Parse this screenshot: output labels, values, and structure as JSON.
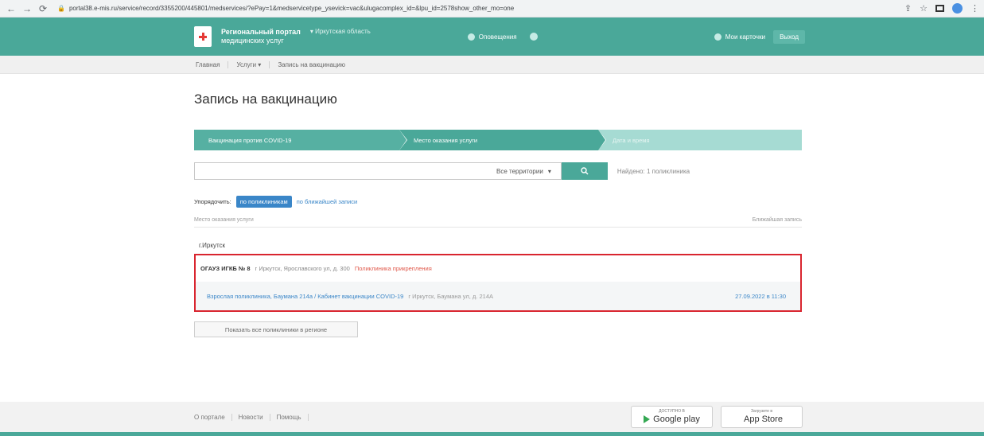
{
  "browser": {
    "url": "portal38.e-mis.ru/service/record/3355200/445801/medservices/?ePay=1&medservicetype_ysevick=vac&ulugacomplex_id=&lpu_id=2578show_other_mo=one",
    "icons": [
      "back-icon",
      "forward-icon",
      "reload-icon",
      "lock-icon",
      "share-icon",
      "star-icon",
      "extensions-icon",
      "profile-icon",
      "menu-icon"
    ]
  },
  "header": {
    "brand_line1": "Региональный портал",
    "brand_line2": "медицинских услуг",
    "region": "Иркутская область",
    "notifications": "Оповещения",
    "my_cards": "Мои карточки",
    "login": "Выход"
  },
  "breadcrumbs": [
    "Главная",
    "Услуги",
    "Запись на вакцинацию"
  ],
  "page": {
    "title": "Запись на вакцинацию"
  },
  "stepper": [
    {
      "label": "Вакцинация против COVID-19"
    },
    {
      "label": "Место оказания услуги"
    },
    {
      "label": "Дата и время"
    }
  ],
  "search": {
    "placeholder": "",
    "territory": "Все территории",
    "found": "Найдено: 1 поликлиника"
  },
  "sort": {
    "label": "Упорядочить:",
    "active": "по поликлиникам",
    "link": "по ближайшей записи"
  },
  "columns": {
    "left": "Место оказания услуги",
    "right": "Ближайшая запись"
  },
  "city": "г.Иркутск",
  "clinic": {
    "name": "ОГАУЗ ИГКБ № 8",
    "address": "г Иркутск, Ярославского ул, д. 300",
    "badge": "Поликлиника прикрепления"
  },
  "cabinet": {
    "name": "Взрослая поликлиника, Баумана 214а / Кабинет вакцинации COVID-19",
    "address": "г Иркутск, Баумана ул, д. 214А",
    "date": "27.09.2022 в 11:30"
  },
  "show_all": "Показать все поликлиники в регионе",
  "footer": {
    "links": [
      "О портале",
      "Новости",
      "Помощь"
    ],
    "google_small": "ДОСТУПНО В",
    "google_big": "Google play",
    "apple_small": "Загрузите в",
    "apple_big": "App Store"
  },
  "colors": {
    "primary": "#4aa899",
    "link": "#3a86c8",
    "highlight": "#d9252f"
  }
}
